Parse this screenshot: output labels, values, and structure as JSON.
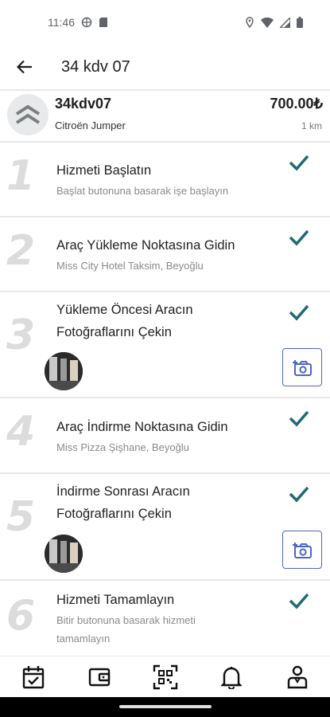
{
  "status_bar": {
    "time": "11:46"
  },
  "header": {
    "title": "34 kdv 07"
  },
  "vehicle": {
    "plate": "34kdv07",
    "model": "Citroën Jumper",
    "price": "700.00₺",
    "distance": "1 km"
  },
  "steps": [
    {
      "number": "1",
      "title": "Hizmeti Başlatın",
      "subtitle": "Başlat butonuna basarak işe başlayın",
      "completed": true
    },
    {
      "number": "2",
      "title": "Araç Yükleme Noktasına Gidin",
      "subtitle": "Miss City Hotel Taksim, Beyoğlu",
      "completed": true
    },
    {
      "number": "3",
      "title_line1": "Yükleme Öncesi Aracın",
      "title_line2": "Fotoğraflarını Çekin",
      "completed": true
    },
    {
      "number": "4",
      "title": "Araç İndirme Noktasına Gidin",
      "subtitle": "Miss Pizza Şişhane, Beyoğlu",
      "completed": true
    },
    {
      "number": "5",
      "title_line1": "İndirme Sonrası Aracın",
      "title_line2": "Fotoğraflarını Çekin",
      "completed": true
    },
    {
      "number": "6",
      "title": "Hizmeti Tamamlayın",
      "subtitle_line1": "Bitir butonuna basarak hizmeti",
      "subtitle_line2": "tamamlayın",
      "completed": true
    }
  ],
  "colors": {
    "check": "#1d6b6f",
    "accent": "#4a67c4",
    "step_number": "#dcdcdc"
  },
  "bottom_nav": [
    "calendar-check-icon",
    "wallet-icon",
    "qr-scan-icon",
    "bell-icon",
    "user-badge-icon"
  ]
}
